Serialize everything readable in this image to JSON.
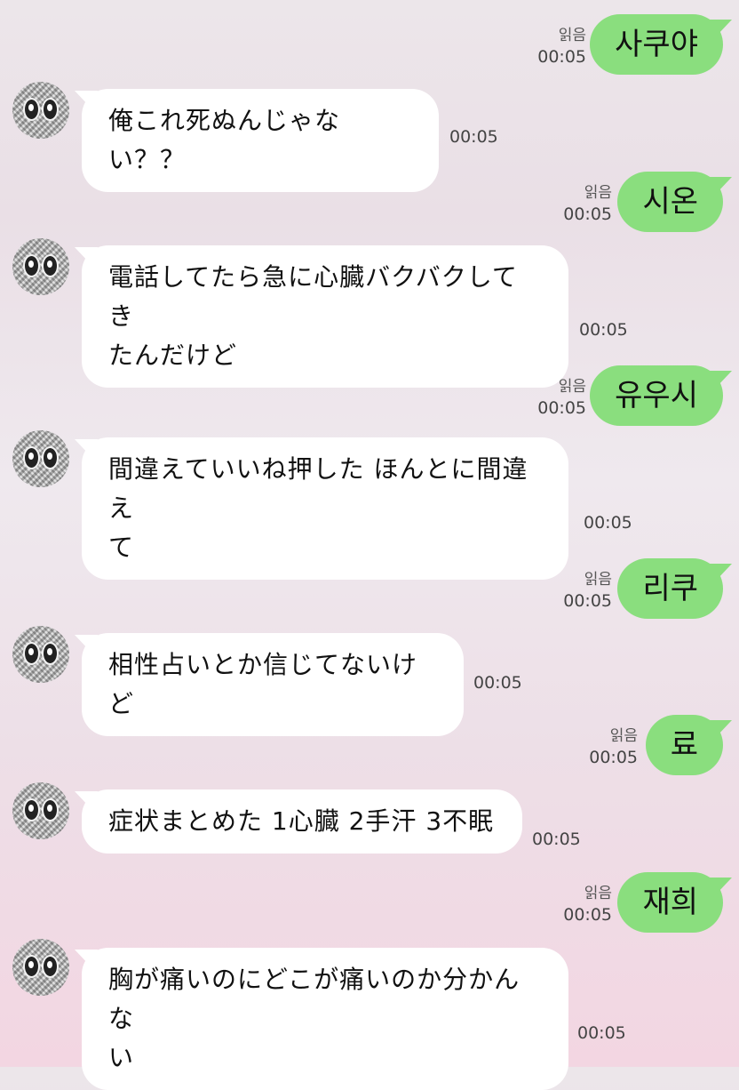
{
  "messages": [
    {
      "dir": "out",
      "text": "사쿠야",
      "read": "읽음",
      "time": "00:05"
    },
    {
      "dir": "in",
      "text": "俺これ死ぬんじゃない？？",
      "time": "00:05"
    },
    {
      "dir": "out",
      "text": "시온",
      "read": "읽음",
      "time": "00:05"
    },
    {
      "dir": "in",
      "lines": [
        "電話してたら急に心臓バクバクしてき",
        "たんだけど"
      ],
      "time": "00:05"
    },
    {
      "dir": "out",
      "text": "유우시",
      "read": "읽음",
      "time": "00:05"
    },
    {
      "dir": "in",
      "lines": [
        "間違えていいね押した ほんとに間違え",
        "て"
      ],
      "time": "00:05"
    },
    {
      "dir": "out",
      "text": "리쿠",
      "read": "읽음",
      "time": "00:05"
    },
    {
      "dir": "in",
      "text": "相性占いとか信じてないけど",
      "time": "00:05"
    },
    {
      "dir": "out",
      "text": "료",
      "read": "읽음",
      "time": "00:05"
    },
    {
      "dir": "in",
      "text": "症状まとめた 1心臓 2手汗 3不眠",
      "time": "00:05"
    },
    {
      "dir": "out",
      "text": "재희",
      "read": "읽음",
      "time": "00:05"
    },
    {
      "dir": "in",
      "lines": [
        "胸が痛いのにどこが痛いのか分かんな",
        "い"
      ],
      "time": "00:05"
    }
  ],
  "colors": {
    "outgoing_bubble": "#8ade7e",
    "incoming_bubble": "#ffffff"
  },
  "icons": {
    "avatar": "pixelated-face-avatar-icon"
  }
}
